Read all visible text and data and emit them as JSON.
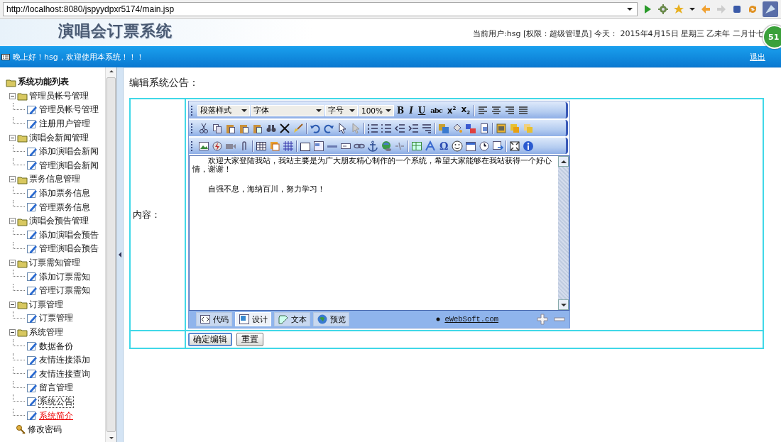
{
  "browser": {
    "url": "http://localhost:8080/jspyydpxr5174/main.jsp"
  },
  "header": {
    "title": "演唱会订票系统",
    "user_info": "当前用户:hsg [权限：超级管理员] 今天： 2015年4月15日 星期三 乙未年 二月廿七",
    "badge": "51"
  },
  "welcome_bar": {
    "greeting": "晚上好！hsg，欢迎使用本系统！！！",
    "logout": "退出"
  },
  "sidebar": {
    "root": "系统功能列表",
    "items": [
      {
        "kind": "folder",
        "label": "管理员帐号管理",
        "expanded": true,
        "children": [
          {
            "label": "管理员帐号管理",
            "selected": false,
            "hovered": false
          },
          {
            "label": "注册用户管理",
            "selected": false,
            "hovered": false
          }
        ]
      },
      {
        "kind": "folder",
        "label": "演唱会新闻管理",
        "expanded": true,
        "children": [
          {
            "label": "添加演唱会新闻",
            "selected": false,
            "hovered": false
          },
          {
            "label": "管理演唱会新闻",
            "selected": false,
            "hovered": false
          }
        ]
      },
      {
        "kind": "folder",
        "label": "票务信息管理",
        "expanded": true,
        "children": [
          {
            "label": "添加票务信息",
            "selected": false,
            "hovered": false
          },
          {
            "label": "管理票务信息",
            "selected": false,
            "hovered": false
          }
        ]
      },
      {
        "kind": "folder",
        "label": "演唱会预告管理",
        "expanded": true,
        "children": [
          {
            "label": "添加演唱会预告",
            "selected": false,
            "hovered": false
          },
          {
            "label": "管理演唱会预告",
            "selected": false,
            "hovered": false
          }
        ]
      },
      {
        "kind": "folder",
        "label": "订票需知管理",
        "expanded": true,
        "children": [
          {
            "label": "添加订票需知",
            "selected": false,
            "hovered": false
          },
          {
            "label": "管理订票需知",
            "selected": false,
            "hovered": false
          }
        ]
      },
      {
        "kind": "folder",
        "label": "订票管理",
        "expanded": true,
        "children": [
          {
            "label": "订票管理",
            "selected": false,
            "hovered": false
          }
        ]
      },
      {
        "kind": "folder",
        "label": "系统管理",
        "expanded": true,
        "children": [
          {
            "label": "数据备份",
            "selected": false,
            "hovered": false
          },
          {
            "label": "友情连接添加",
            "selected": false,
            "hovered": false
          },
          {
            "label": "友情连接查询",
            "selected": false,
            "hovered": false
          },
          {
            "label": "留言管理",
            "selected": false,
            "hovered": false
          },
          {
            "label": "系统公告",
            "selected": true,
            "hovered": false
          },
          {
            "label": "系统简介",
            "selected": false,
            "hovered": true
          }
        ]
      },
      {
        "kind": "key",
        "label": "修改密码"
      }
    ]
  },
  "main": {
    "page_title": "编辑系统公告：",
    "content_label": "内容：",
    "editor": {
      "selects": [
        "段落样式",
        "字体",
        "字号",
        "100%"
      ],
      "format_buttons": [
        "B",
        "I",
        "U",
        "abc",
        "x$^{2}$",
        "x$_{2}$"
      ],
      "symbol_button": "Ω",
      "paragraphs": [
        "欢迎大家登陆我站，我站主要是为广大朋友精心制作的一个系统，希望大家能够在我站获得一个好心情，谢谢！",
        "自强不息，海纳百川，努力学习！"
      ],
      "modes": [
        {
          "label": "代码",
          "selected": false
        },
        {
          "label": "设计",
          "selected": true
        },
        {
          "label": "文本",
          "selected": false
        },
        {
          "label": "预览",
          "selected": false
        }
      ],
      "credit_link": "eWebSoft.com"
    },
    "buttons": [
      {
        "label": "确定编辑",
        "default": true
      },
      {
        "label": "重置",
        "default": false
      }
    ]
  }
}
